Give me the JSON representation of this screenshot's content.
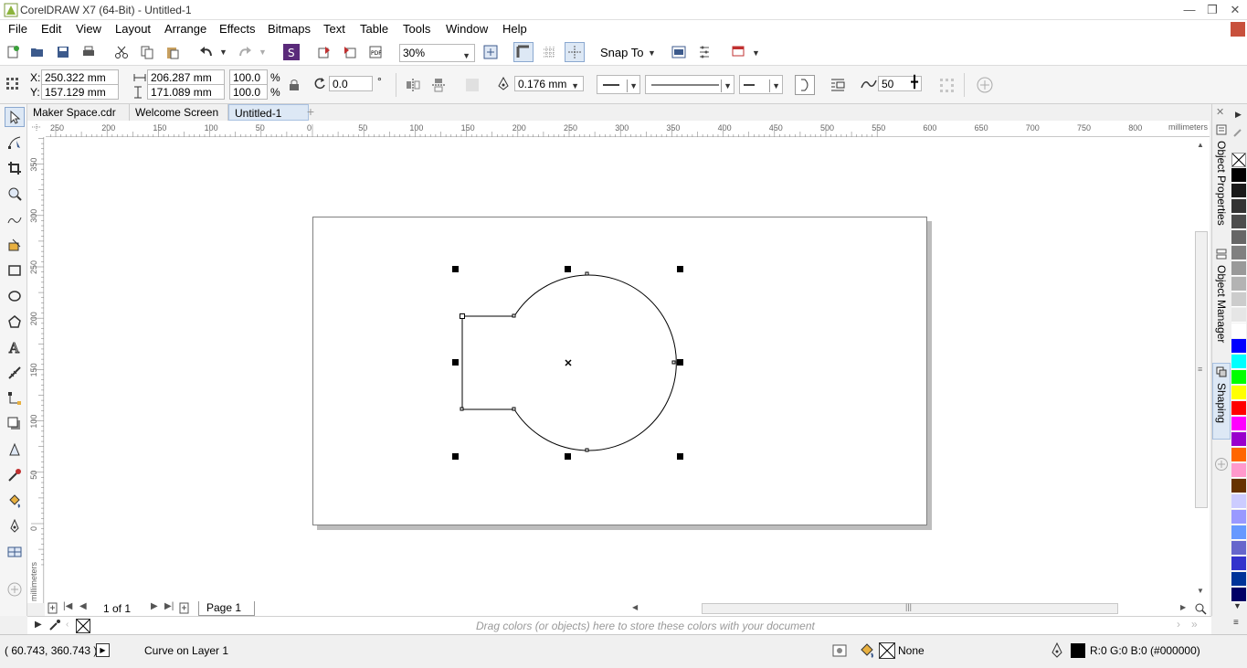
{
  "app": {
    "title": "CorelDRAW X7 (64-Bit) - Untitled-1"
  },
  "menu": [
    "File",
    "Edit",
    "View",
    "Layout",
    "Arrange",
    "Effects",
    "Bitmaps",
    "Text",
    "Table",
    "Tools",
    "Window",
    "Help"
  ],
  "standard_toolbar": {
    "zoom_level": "30%",
    "snap_to_label": "Snap To"
  },
  "property_bar": {
    "x": "250.322 mm",
    "y": "157.129 mm",
    "x_label": "X:",
    "y_label": "Y:",
    "width": "206.287 mm",
    "height": "171.089 mm",
    "scale_w": "100.0",
    "scale_h": "100.0",
    "pct": "%",
    "rotation": "0.0",
    "deg": "°",
    "outline_width": "0.176 mm",
    "smoothing": "50"
  },
  "document_tabs": [
    "Maker Space.cdr",
    "Welcome Screen",
    "Untitled-1"
  ],
  "active_tab_index": 2,
  "ruler": {
    "h_labels": [
      "250",
      "200",
      "150",
      "100",
      "50",
      "0",
      "50",
      "100",
      "150",
      "200",
      "250",
      "300",
      "350",
      "400",
      "450",
      "500",
      "550",
      "600",
      "650",
      "700",
      "750",
      "800"
    ],
    "v_labels": [
      "350",
      "300",
      "250",
      "200",
      "150",
      "100",
      "50",
      "0"
    ],
    "unit": "millimeters"
  },
  "page_nav": {
    "counter": "1 of 1",
    "page_tab": "Page 1"
  },
  "dockers": [
    "Object Properties",
    "Object Manager",
    "Shaping"
  ],
  "document_palette_hint": "Drag colors (or objects) here to store these colors with your document",
  "palette_colors": [
    "#000000",
    "#1a1a1a",
    "#333333",
    "#4d4d4d",
    "#666666",
    "#808080",
    "#999999",
    "#b3b3b3",
    "#cccccc",
    "#e6e6e6",
    "#ffffff",
    "#0000ff",
    "#00ffff",
    "#00ff00",
    "#ffff00",
    "#ff0000",
    "#ff00ff",
    "#9900cc",
    "#ff6600",
    "#ff99cc",
    "#663300",
    "#ccccff",
    "#9999ff",
    "#6699ff",
    "#6666cc",
    "#3333cc",
    "#003399",
    "#000066"
  ],
  "status": {
    "coords": "( 60.743, 360.743 )",
    "object_info": "Curve on Layer 1",
    "fill": "None",
    "outline_color": "R:0 G:0 B:0 (#000000)"
  }
}
